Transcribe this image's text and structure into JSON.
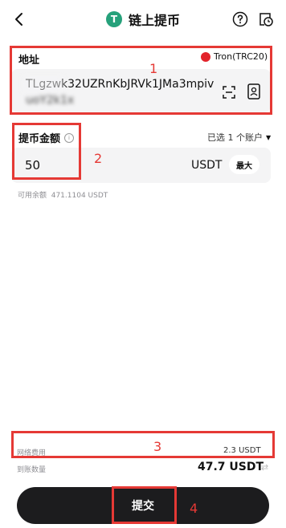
{
  "header": {
    "title": "链上提币",
    "coin_badge_letter": "T"
  },
  "address": {
    "label": "地址",
    "network": "Tron(TRC20)",
    "value_line1": "TLgzwk32UZRnKbJRVk1JMa3mpiv",
    "value_line2": "uoY2k1x"
  },
  "amount": {
    "label": "提币金额",
    "account_selector": "已选 1 个账户",
    "value": "50",
    "currency": "USDT",
    "max_label": "最大",
    "available": "可用余额  471.1104 USDT"
  },
  "fee": {
    "label": "网络费用",
    "value": "2.3 USDT"
  },
  "receive": {
    "label": "到账数量",
    "value": "47.7 USDT"
  },
  "submit_label": "提交",
  "annotations": [
    "1",
    "2",
    "3",
    "4"
  ],
  "colors": {
    "accent_red": "#e53935",
    "tron_red": "#e2232b",
    "tether_green": "#26a17b"
  }
}
